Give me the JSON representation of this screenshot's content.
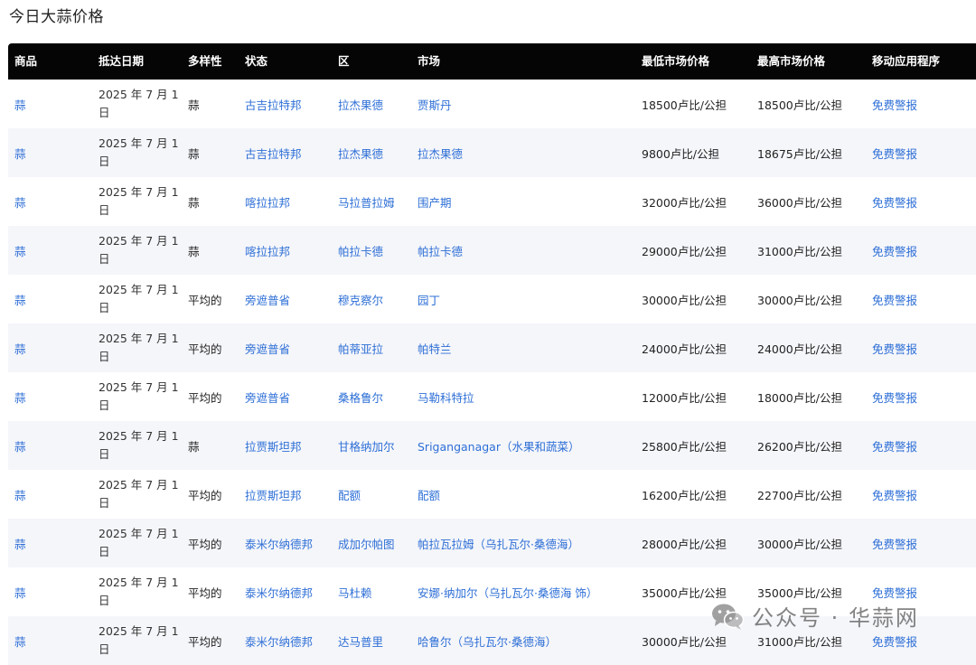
{
  "page_title": "今日大蒜价格",
  "headers": [
    "商品",
    "抵达日期",
    "多样性",
    "状态",
    "区",
    "市场",
    "最低市场价格",
    "最高市场价格",
    "移动应用程序"
  ],
  "rows": [
    {
      "commodity": "蒜",
      "date": "2025 年 7 月 1 日",
      "variety": "蒜",
      "state": "古吉拉特邦",
      "district": "拉杰果德",
      "market": "贾斯丹",
      "min_price": "18500卢比/公担",
      "max_price": "18500卢比/公担",
      "app": "免费警报"
    },
    {
      "commodity": "蒜",
      "date": "2025 年 7 月 1 日",
      "variety": "蒜",
      "state": "古吉拉特邦",
      "district": "拉杰果德",
      "market": "拉杰果德",
      "min_price": "9800卢比/公担",
      "max_price": "18675卢比/公担",
      "app": "免费警报"
    },
    {
      "commodity": "蒜",
      "date": "2025 年 7 月 1 日",
      "variety": "蒜",
      "state": "喀拉拉邦",
      "district": "马拉普拉姆",
      "market": "围产期",
      "min_price": "32000卢比/公担",
      "max_price": "36000卢比/公担",
      "app": "免费警报"
    },
    {
      "commodity": "蒜",
      "date": "2025 年 7 月 1 日",
      "variety": "蒜",
      "state": "喀拉拉邦",
      "district": "帕拉卡德",
      "market": "帕拉卡德",
      "min_price": "29000卢比/公担",
      "max_price": "31000卢比/公担",
      "app": "免费警报"
    },
    {
      "commodity": "蒜",
      "date": "2025 年 7 月 1 日",
      "variety": "平均的",
      "state": "旁遮普省",
      "district": "穆克察尔",
      "market": "园丁",
      "min_price": "30000卢比/公担",
      "max_price": "30000卢比/公担",
      "app": "免费警报"
    },
    {
      "commodity": "蒜",
      "date": "2025 年 7 月 1 日",
      "variety": "平均的",
      "state": "旁遮普省",
      "district": "帕蒂亚拉",
      "market": "帕特兰",
      "min_price": "24000卢比/公担",
      "max_price": "24000卢比/公担",
      "app": "免费警报"
    },
    {
      "commodity": "蒜",
      "date": "2025 年 7 月 1 日",
      "variety": "平均的",
      "state": "旁遮普省",
      "district": "桑格鲁尔",
      "market": "马勒科特拉",
      "min_price": "12000卢比/公担",
      "max_price": "18000卢比/公担",
      "app": "免费警报"
    },
    {
      "commodity": "蒜",
      "date": "2025 年 7 月 1 日",
      "variety": "蒜",
      "state": "拉贾斯坦邦",
      "district": "甘格纳加尔",
      "market": "Sriganganagar（水果和蔬菜）",
      "min_price": "25800卢比/公担",
      "max_price": "26200卢比/公担",
      "app": "免费警报"
    },
    {
      "commodity": "蒜",
      "date": "2025 年 7 月 1 日",
      "variety": "平均的",
      "state": "拉贾斯坦邦",
      "district": "配额",
      "market": "配额",
      "min_price": "16200卢比/公担",
      "max_price": "22700卢比/公担",
      "app": "免费警报"
    },
    {
      "commodity": "蒜",
      "date": "2025 年 7 月 1 日",
      "variety": "平均的",
      "state": "泰米尔纳德邦",
      "district": "成加尔帕图",
      "market": "帕拉瓦拉姆（乌扎瓦尔·桑德海）",
      "min_price": "28000卢比/公担",
      "max_price": "30000卢比/公担",
      "app": "免费警报"
    },
    {
      "commodity": "蒜",
      "date": "2025 年 7 月 1 日",
      "variety": "平均的",
      "state": "泰米尔纳德邦",
      "district": "马杜赖",
      "market": "安娜·纳加尔（乌扎瓦尔·桑德海 饰）",
      "min_price": "35000卢比/公担",
      "max_price": "35000卢比/公担",
      "app": "免费警报"
    },
    {
      "commodity": "蒜",
      "date": "2025 年 7 月 1 日",
      "variety": "平均的",
      "state": "泰米尔纳德邦",
      "district": "达马普里",
      "market": "哈鲁尔（乌扎瓦尔·桑德海）",
      "min_price": "30000卢比/公担",
      "max_price": "31000卢比/公担",
      "app": "免费警报"
    }
  ],
  "watermark": {
    "text": "公众号 · 华蒜网",
    "icon": "wechat-icon"
  },
  "colors": {
    "header_bg": "#050505",
    "link": "#2e6fd6",
    "alt_row": "#f5f6fa"
  }
}
